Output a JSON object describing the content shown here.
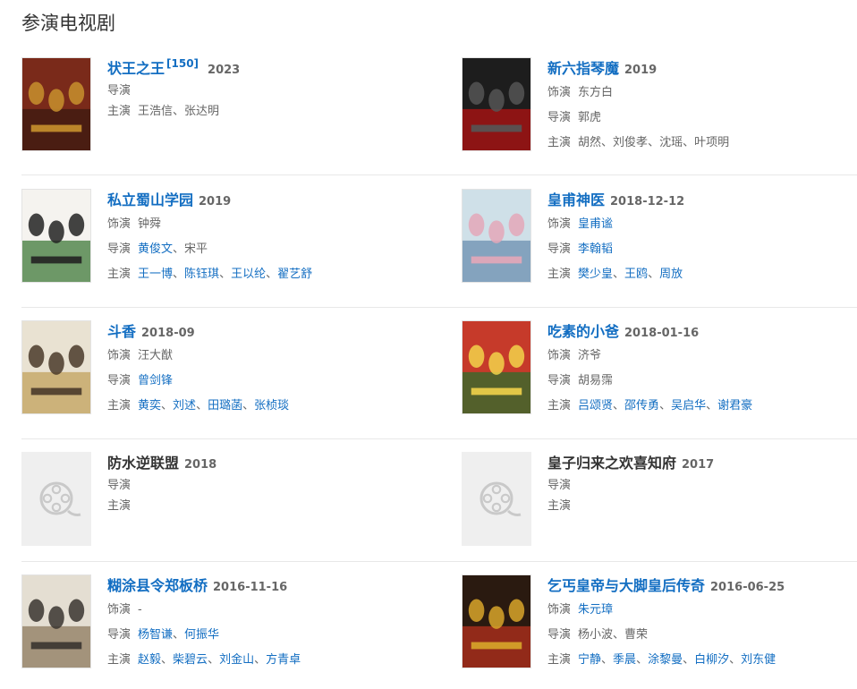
{
  "section_title": "参演电视剧",
  "labels": {
    "role": "饰演",
    "director": "导演",
    "actors": "主演"
  },
  "colors": {
    "link": "#136ec2",
    "text": "#333333",
    "muted": "#666666",
    "separator": "#e8e8e8",
    "placeholder_bg": "#efefef"
  },
  "dramas": [
    {
      "title": "状王之王",
      "ref": "[150]",
      "year": "2023",
      "title_link": true,
      "poster": "poster-image",
      "director": [],
      "actors": [
        {
          "t": "王浩信",
          "link": false
        },
        {
          "t": "张达明",
          "link": false
        }
      ],
      "role": null,
      "lines": [
        "director",
        "actors"
      ]
    },
    {
      "title": "新六指琴魔",
      "ref": "",
      "year": "2019",
      "title_link": true,
      "poster": "poster-image",
      "role": [
        {
          "t": "东方白",
          "link": false
        }
      ],
      "director": [
        {
          "t": "郭虎",
          "link": false
        }
      ],
      "actors": [
        {
          "t": "胡然",
          "link": false
        },
        {
          "t": "刘俊孝",
          "link": false
        },
        {
          "t": "沈瑶",
          "link": false
        },
        {
          "t": "叶项明",
          "link": false
        }
      ],
      "lines": [
        "role",
        "director",
        "actors"
      ]
    },
    {
      "title": "私立蜀山学园",
      "ref": "",
      "year": "2019",
      "title_link": true,
      "poster": "poster-image",
      "role": [
        {
          "t": "钟舜",
          "link": false
        }
      ],
      "director": [
        {
          "t": "黄俊文",
          "link": true
        },
        {
          "t": "宋平",
          "link": false
        }
      ],
      "actors": [
        {
          "t": "王一博",
          "link": true
        },
        {
          "t": "陈钰琪",
          "link": true
        },
        {
          "t": "王以纶",
          "link": true
        },
        {
          "t": "翟艺舒",
          "link": true
        }
      ],
      "lines": [
        "role",
        "director",
        "actors"
      ]
    },
    {
      "title": "皇甫神医",
      "ref": "",
      "year": "2018-12-12",
      "title_link": true,
      "poster": "poster-image",
      "role": [
        {
          "t": "皇甫谧",
          "link": true
        }
      ],
      "director": [
        {
          "t": "李翰韬",
          "link": true
        }
      ],
      "actors": [
        {
          "t": "樊少皇",
          "link": true
        },
        {
          "t": "王鸥",
          "link": true
        },
        {
          "t": "周放",
          "link": true
        }
      ],
      "lines": [
        "role",
        "director",
        "actors"
      ]
    },
    {
      "title": "斗香",
      "ref": "",
      "year": "2018-09",
      "title_link": true,
      "poster": "poster-image",
      "role": [
        {
          "t": "汪大猷",
          "link": false
        }
      ],
      "director": [
        {
          "t": "曾剑锋",
          "link": true
        }
      ],
      "actors": [
        {
          "t": "黄奕",
          "link": true
        },
        {
          "t": "刘述",
          "link": true
        },
        {
          "t": "田璐菡",
          "link": true
        },
        {
          "t": "张桢琰",
          "link": true
        }
      ],
      "lines": [
        "role",
        "director",
        "actors"
      ]
    },
    {
      "title": "吃素的小爸",
      "ref": "",
      "year": "2018-01-16",
      "title_link": true,
      "poster": "poster-image",
      "role": [
        {
          "t": "济爷",
          "link": false
        }
      ],
      "director": [
        {
          "t": "胡易霈",
          "link": false
        }
      ],
      "actors": [
        {
          "t": "吕颂贤",
          "link": true
        },
        {
          "t": "邵传勇",
          "link": true
        },
        {
          "t": "吴启华",
          "link": true
        },
        {
          "t": "谢君豪",
          "link": true
        }
      ],
      "lines": [
        "role",
        "director",
        "actors"
      ]
    },
    {
      "title": "防水逆联盟",
      "ref": "",
      "year": "2018",
      "title_link": false,
      "poster": "placeholder",
      "role": null,
      "director": [],
      "actors": [],
      "lines": [
        "director",
        "actors"
      ]
    },
    {
      "title": "皇子归来之欢喜知府",
      "ref": "",
      "year": "2017",
      "title_link": false,
      "poster": "placeholder",
      "role": null,
      "director": [],
      "actors": [],
      "lines": [
        "director",
        "actors"
      ]
    },
    {
      "title": "糊涂县令郑板桥",
      "ref": "",
      "year": "2016-11-16",
      "title_link": true,
      "poster": "poster-image",
      "role": [
        {
          "t": "-",
          "link": false
        }
      ],
      "director": [
        {
          "t": "杨智谦",
          "link": true
        },
        {
          "t": "何振华",
          "link": true
        }
      ],
      "actors": [
        {
          "t": "赵毅",
          "link": true
        },
        {
          "t": "柴碧云",
          "link": true
        },
        {
          "t": "刘金山",
          "link": true
        },
        {
          "t": "方青卓",
          "link": true
        }
      ],
      "lines": [
        "role",
        "director",
        "actors"
      ]
    },
    {
      "title": "乞丐皇帝与大脚皇后传奇",
      "ref": "",
      "year": "2016-06-25",
      "title_link": true,
      "poster": "poster-image",
      "role": [
        {
          "t": "朱元璋",
          "link": true
        }
      ],
      "director": [
        {
          "t": "杨小波",
          "link": false
        },
        {
          "t": "曹荣",
          "link": false
        }
      ],
      "actors": [
        {
          "t": "宁静",
          "link": true
        },
        {
          "t": "季晨",
          "link": true
        },
        {
          "t": "涂黎曼",
          "link": true
        },
        {
          "t": "白柳汐",
          "link": true
        },
        {
          "t": "刘东健",
          "link": true
        }
      ],
      "lines": [
        "role",
        "director",
        "actors"
      ]
    }
  ]
}
